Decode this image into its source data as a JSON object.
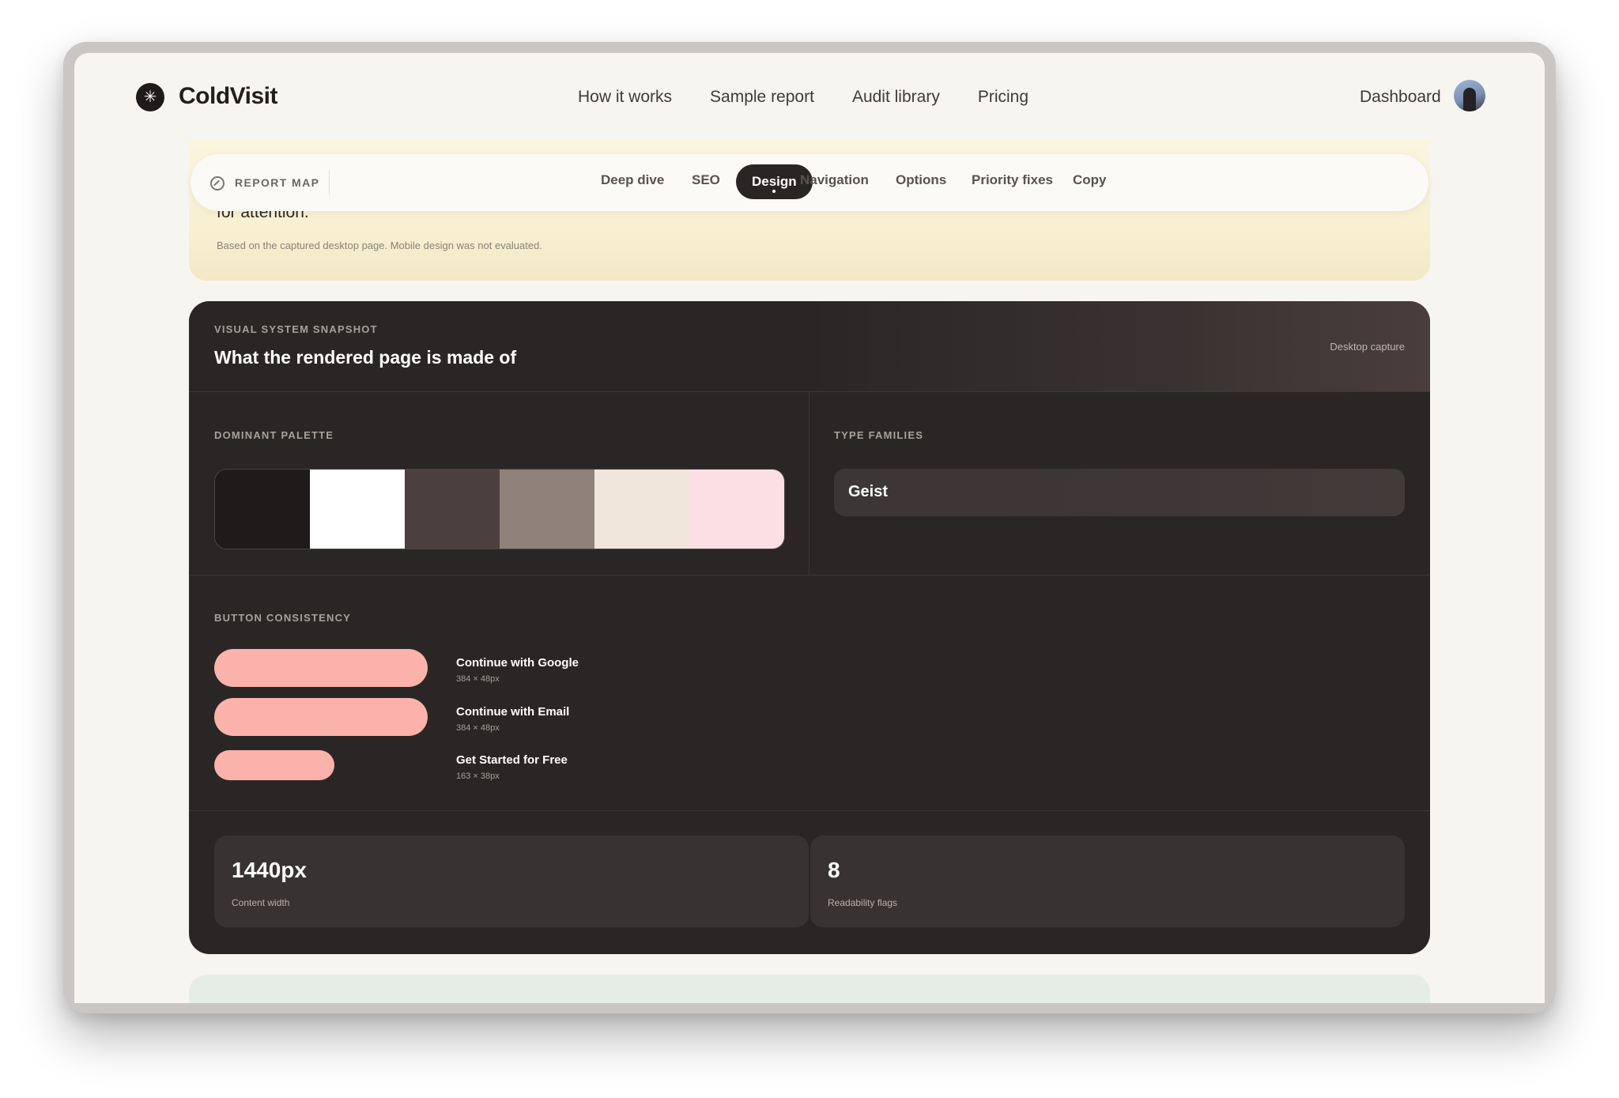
{
  "brand": {
    "name": "ColdVisit",
    "logo_glyph": "✳"
  },
  "nav": {
    "links": [
      "How it works",
      "Sample report",
      "Audit library",
      "Pricing"
    ],
    "dashboard": "Dashboard"
  },
  "intro": {
    "cut_text": "for attention.",
    "note": "Based on the captured desktop page. Mobile design was not evaluated."
  },
  "report_map": {
    "label": "REPORT MAP",
    "icon": "compass-icon",
    "tabs": [
      "Deep dive",
      "SEO",
      "Design",
      "Navigation",
      "Options",
      "Priority fixes",
      "Copy"
    ],
    "active_tab": "Design"
  },
  "snapshot": {
    "eyebrow": "VISUAL SYSTEM SNAPSHOT",
    "title": "What the rendered page is made of",
    "capture_label": "Desktop capture",
    "palette_label": "DOMINANT PALETTE",
    "palette": [
      "#1f1b1b",
      "#ffffff",
      "#4b403d",
      "#8e827a",
      "#f0e5da",
      "#fbdfe5"
    ],
    "type_label": "TYPE FAMILIES",
    "type_families": [
      "Geist"
    ],
    "button_label": "BUTTON CONSISTENCY",
    "button_color": "#fbb2ab",
    "buttons": [
      {
        "name": "Continue with Google",
        "size": "384 × 48px"
      },
      {
        "name": "Continue with Email",
        "size": "384 × 48px"
      },
      {
        "name": "Get Started for Free",
        "size": "163 × 38px"
      }
    ],
    "stats": [
      {
        "value": "1440px",
        "label": "Content width"
      },
      {
        "value": "8",
        "label": "Readability flags"
      }
    ]
  }
}
